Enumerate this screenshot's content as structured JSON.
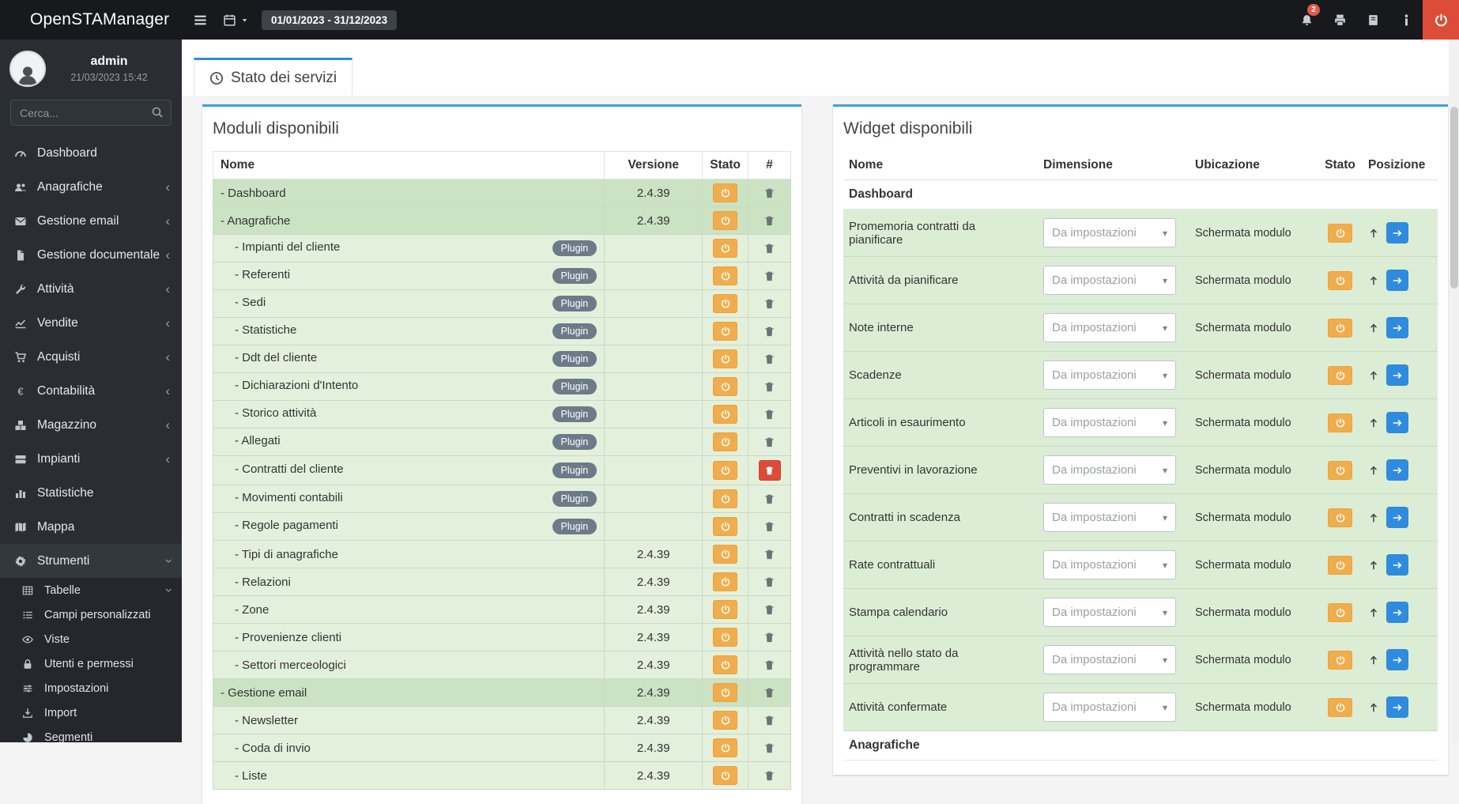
{
  "colors": {
    "accent-blue": "#2f8be0",
    "card-top": "#39a4d6",
    "warning": "#f0ad4e",
    "danger": "#dd4b39",
    "row-main": "#cbe3c3",
    "row-sub": "#e3f1dc",
    "row-widget": "#dcedd5",
    "badge-gray": "#6c7a89"
  },
  "topbar": {
    "brand": "OpenSTAManager",
    "date_range": "01/01/2023 - 31/12/2023",
    "right_icons": [
      {
        "name": "bell",
        "badge": "2"
      },
      {
        "name": "printer"
      },
      {
        "name": "book"
      },
      {
        "name": "info"
      },
      {
        "name": "power",
        "danger": true
      }
    ]
  },
  "sidebar": {
    "user_name": "admin",
    "login_time": "21/03/2023 15:42",
    "search_placeholder": "Cerca...",
    "menu": [
      {
        "label": "Dashboard",
        "icon": "gauge"
      },
      {
        "label": "Anagrafiche",
        "icon": "users",
        "chevron": "left"
      },
      {
        "label": "Gestione email",
        "icon": "envelope",
        "chevron": "left"
      },
      {
        "label": "Gestione documentale",
        "icon": "file",
        "chevron": "left"
      },
      {
        "label": "Attività",
        "icon": "wrench",
        "chevron": "left"
      },
      {
        "label": "Vendite",
        "icon": "chart-line",
        "chevron": "left"
      },
      {
        "label": "Acquisti",
        "icon": "cart",
        "chevron": "left"
      },
      {
        "label": "Contabilità",
        "icon": "euro",
        "chevron": "left"
      },
      {
        "label": "Magazzino",
        "icon": "boxes",
        "chevron": "left"
      },
      {
        "label": "Impianti",
        "icon": "server",
        "chevron": "left"
      },
      {
        "label": "Statistiche",
        "icon": "bar-chart"
      },
      {
        "label": "Mappa",
        "icon": "map"
      },
      {
        "label": "Strumenti",
        "icon": "gear",
        "chevron": "down",
        "active": true
      },
      {
        "label": "Tabelle",
        "icon": "table",
        "chevron": "down",
        "sub": true
      },
      {
        "label": "Campi personalizzati",
        "icon": "list",
        "sub": true
      },
      {
        "label": "Viste",
        "icon": "eye",
        "sub": true
      },
      {
        "label": "Utenti e permessi",
        "icon": "lock",
        "sub": true
      },
      {
        "label": "Impostazioni",
        "icon": "sliders",
        "sub": true
      },
      {
        "label": "Import",
        "icon": "import",
        "sub": true
      },
      {
        "label": "Segmenti",
        "icon": "segments",
        "sub": true
      }
    ]
  },
  "main": {
    "tab_label": "Stato dei servizi",
    "modules": {
      "title": "Moduli disponibili",
      "columns": [
        "Nome",
        "Versione",
        "Stato",
        "#"
      ],
      "plugin_badge": "Plugin",
      "rows": [
        {
          "name": "- Dashboard",
          "version": "2.4.39",
          "main": true
        },
        {
          "name": "- Anagrafiche",
          "version": "2.4.39",
          "main": true
        },
        {
          "name": "- Impianti del cliente",
          "plugin": true
        },
        {
          "name": "- Referenti",
          "plugin": true
        },
        {
          "name": "- Sedi",
          "plugin": true
        },
        {
          "name": "- Statistiche",
          "plugin": true
        },
        {
          "name": "- Ddt del cliente",
          "plugin": true
        },
        {
          "name": "- Dichiarazioni d'Intento",
          "plugin": true
        },
        {
          "name": "- Storico attività",
          "plugin": true
        },
        {
          "name": "- Allegati",
          "plugin": true
        },
        {
          "name": "- Contratti del cliente",
          "plugin": true,
          "danger": true
        },
        {
          "name": "- Movimenti contabili",
          "plugin": true
        },
        {
          "name": "- Regole pagamenti",
          "plugin": true
        },
        {
          "name": "- Tipi di anagrafiche",
          "version": "2.4.39"
        },
        {
          "name": "- Relazioni",
          "version": "2.4.39"
        },
        {
          "name": "- Zone",
          "version": "2.4.39"
        },
        {
          "name": "- Provenienze clienti",
          "version": "2.4.39"
        },
        {
          "name": "- Settori merceologici",
          "version": "2.4.39"
        },
        {
          "name": "- Gestione email",
          "version": "2.4.39",
          "main": true
        },
        {
          "name": "- Newsletter",
          "version": "2.4.39"
        },
        {
          "name": "- Coda di invio",
          "version": "2.4.39"
        },
        {
          "name": "- Liste",
          "version": "2.4.39"
        }
      ]
    },
    "widgets": {
      "title": "Widget disponibili",
      "columns": [
        "Nome",
        "Dimensione",
        "Ubicazione",
        "Stato",
        "Posizione"
      ],
      "section": "Dashboard",
      "dimension_value": "Da impostazioni",
      "location_value": "Schermata modulo",
      "rows": [
        "Promemoria contratti da pianificare",
        "Attività da pianificare",
        "Note interne",
        "Scadenze",
        "Articoli in esaurimento",
        "Preventivi in lavorazione",
        "Contratti in scadenza",
        "Rate contrattuali",
        "Stampa calendario",
        "Attività nello stato da programmare",
        "Attività confermate"
      ],
      "footer_section": "Anagrafiche"
    }
  }
}
